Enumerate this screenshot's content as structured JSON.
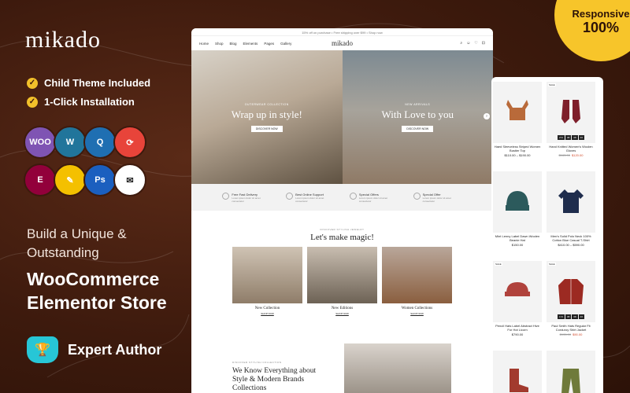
{
  "brand": "mikado",
  "features": [
    {
      "label": "Child Theme Included"
    },
    {
      "label": "1-Click Installation"
    }
  ],
  "plugin_icons": [
    {
      "name": "woocommerce-icon",
      "text": "WOO",
      "color": "#7f54b3"
    },
    {
      "name": "wordpress-icon",
      "text": "W",
      "color": "#21759b"
    },
    {
      "name": "q-icon",
      "text": "Q",
      "color": "#1f6fb2"
    },
    {
      "name": "sync-icon",
      "text": "⟳",
      "color": "#e8443a"
    },
    {
      "name": "elementor-icon",
      "text": "E",
      "color": "#92003b"
    },
    {
      "name": "edit-icon",
      "text": "✎",
      "color": "#f4c000"
    },
    {
      "name": "photoshop-icon",
      "text": "Ps",
      "color": "#1b5fbf"
    },
    {
      "name": "mailchimp-icon",
      "text": "✉",
      "color": "#ffffff"
    }
  ],
  "headline_small": [
    "Build a Unique &",
    "Outstanding"
  ],
  "headline_big": [
    "WooCommerce",
    "Elementor Store"
  ],
  "author": "Expert Author",
  "badge": {
    "line1": "Responsive",
    "line2": "100%"
  },
  "mock": {
    "topbar": "15% off on purchase • Free shipping over $99 • Shop now",
    "nav": [
      "Home",
      "Shop",
      "Blog",
      "Elements",
      "Pages",
      "Gallery"
    ],
    "logo": "mikado",
    "hero": [
      {
        "kicker": "OUTERWEAR COLLECTION",
        "title": "Wrap up in style!",
        "button": "DISCOVER NOW"
      },
      {
        "kicker": "NEW ARRIVALS",
        "title": "With Love to you",
        "button": "DISCOVER NOW"
      }
    ],
    "services": [
      {
        "title": "Free Fast Delivery",
        "desc": "Lorem ipsum dolor sit amet consectetur"
      },
      {
        "title": "Best Online Support",
        "desc": "Lorem ipsum dolor sit amet consectetur"
      },
      {
        "title": "Special Offers",
        "desc": "Lorem ipsum dolor sit amet consectetur"
      },
      {
        "title": "Special Offer",
        "desc": "Lorem ipsum dolor sit amet consectetur"
      }
    ],
    "magic_kicker": "DISCOVER STYLISH JEWELRY",
    "magic_title": "Let's make magic!",
    "collections": [
      {
        "label": "New Collection",
        "button": "SHOP NOW"
      },
      {
        "label": "New Editions",
        "button": "SHOP NOW"
      },
      {
        "label": "Women Collections",
        "button": "SHOP NOW"
      }
    ],
    "bottom_kicker": "DISCOVER STYLISH COLLECTION",
    "bottom_title": "We Know Everything about Style & Modern Brands Collections"
  },
  "products": [
    {
      "name": "Haed Sleeveless Striped Women Bustier Top",
      "old": "",
      "price": "$110.00 – $190.00",
      "sale": "",
      "color": "#b96a3a",
      "shape": "top",
      "countdown": []
    },
    {
      "name": "Hand Knitted Women's Woolen Gloves",
      "old": "$165.00",
      "price": "$120.00",
      "sale": "SALE",
      "color": "#7e1f2b",
      "shape": "glove",
      "countdown": [
        "272",
        "08",
        "08",
        "46"
      ]
    },
    {
      "name": "Mint Lenny Label Dawn Woolen Beanie Hat",
      "old": "",
      "price": "$150.00",
      "sale": "",
      "color": "#2c5a5c",
      "shape": "hat",
      "countdown": []
    },
    {
      "name": "Men's Solid Polo Neck 100% Cotton Blue Casual T-Shirt",
      "old": "",
      "price": "$410.00 – $590.00",
      "sale": "",
      "color": "#1f2d4d",
      "shape": "shirt",
      "countdown": []
    },
    {
      "name": "Pencil Hats Label Abstract Hive For Hot Licorn",
      "old": "",
      "price": "$790.00",
      "sale": "SALE",
      "color": "#b0423c",
      "shape": "cap",
      "countdown": []
    },
    {
      "name": "Paul Smith Hats Regular Fit Corduroy Shirt Jacket",
      "old": "$135.00",
      "price": "$90.00",
      "sale": "SALE",
      "color": "#9c2a22",
      "shape": "jacket",
      "countdown": [
        "172",
        "08",
        "08",
        "46"
      ]
    },
    {
      "name": "",
      "old": "",
      "price": "",
      "sale": "",
      "color": "#a23a2e",
      "shape": "boot",
      "countdown": []
    },
    {
      "name": "",
      "old": "",
      "price": "",
      "sale": "",
      "color": "#6f7a3a",
      "shape": "pants",
      "countdown": []
    }
  ]
}
